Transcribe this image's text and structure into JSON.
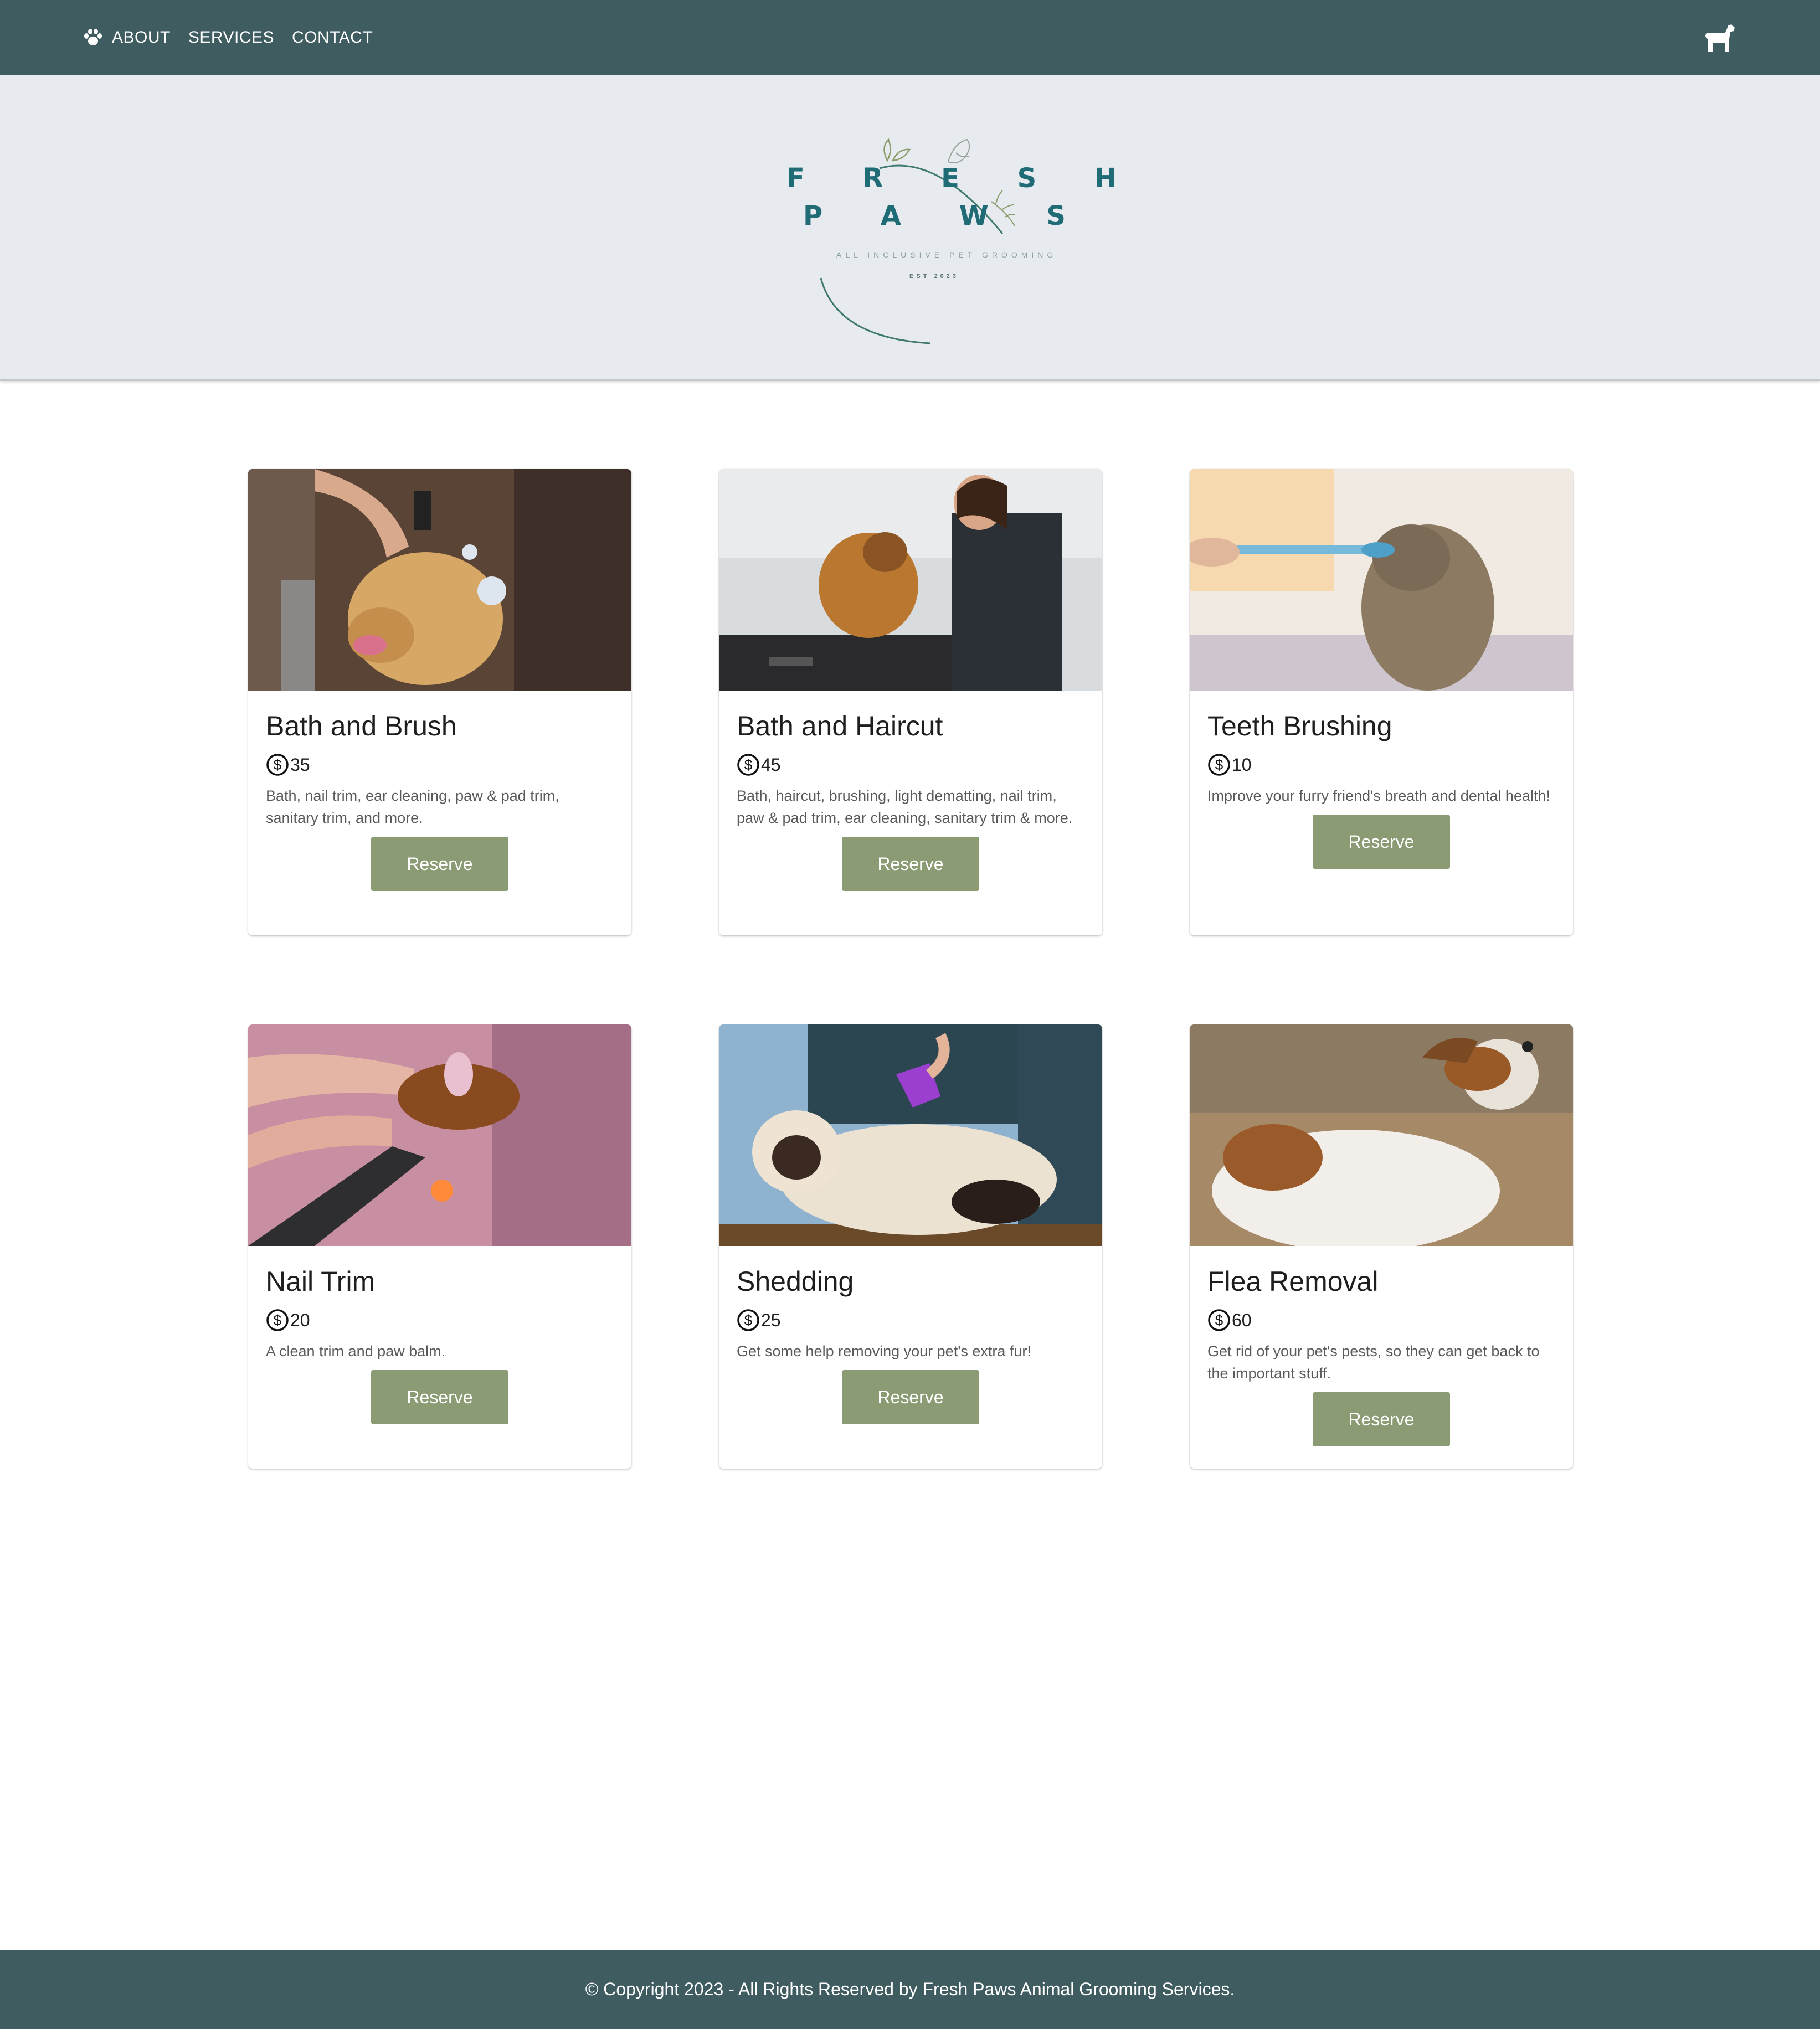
{
  "nav": {
    "links": [
      {
        "label": "ABOUT"
      },
      {
        "label": "SERVICES"
      },
      {
        "label": "CONTACT"
      }
    ],
    "icon_left": "paw-icon",
    "icon_right": "dog-icon"
  },
  "logo": {
    "line1": "F R E S H",
    "line2": "P A W S",
    "tagline": "ALL INCLUSIVE PET GROOMING",
    "est": "EST 2023"
  },
  "services": [
    {
      "title": "Bath and Brush",
      "price": "35",
      "description": "Bath, nail trim, ear cleaning, paw & pad trim, sanitary trim, and more.",
      "button": "Reserve"
    },
    {
      "title": "Bath and Haircut",
      "price": "45",
      "description": "Bath, haircut, brushing, light dematting, nail trim, paw & pad trim, ear cleaning, sanitary trim & more.",
      "button": "Reserve"
    },
    {
      "title": "Teeth Brushing",
      "price": "10",
      "description": "Improve your furry friend's breath and dental health!",
      "button": "Reserve"
    },
    {
      "title": "Nail Trim",
      "price": "20",
      "description": "A clean trim and paw balm.",
      "button": "Reserve"
    },
    {
      "title": "Shedding",
      "price": "25",
      "description": "Get some help removing your pet's extra fur!",
      "button": "Reserve"
    },
    {
      "title": "Flea Removal",
      "price": "60",
      "description": "Get rid of your pet's pests, so they can get back to the important stuff.",
      "button": "Reserve"
    }
  ],
  "footer": {
    "text": "© Copyright 2023 - All Rights Reserved by Fresh Paws Animal Grooming Services."
  },
  "colors": {
    "navbar": "#3f5c60",
    "hero_bg": "#e7eaee",
    "logo_teal": "#1f6b76",
    "button": "#8b9b74"
  }
}
